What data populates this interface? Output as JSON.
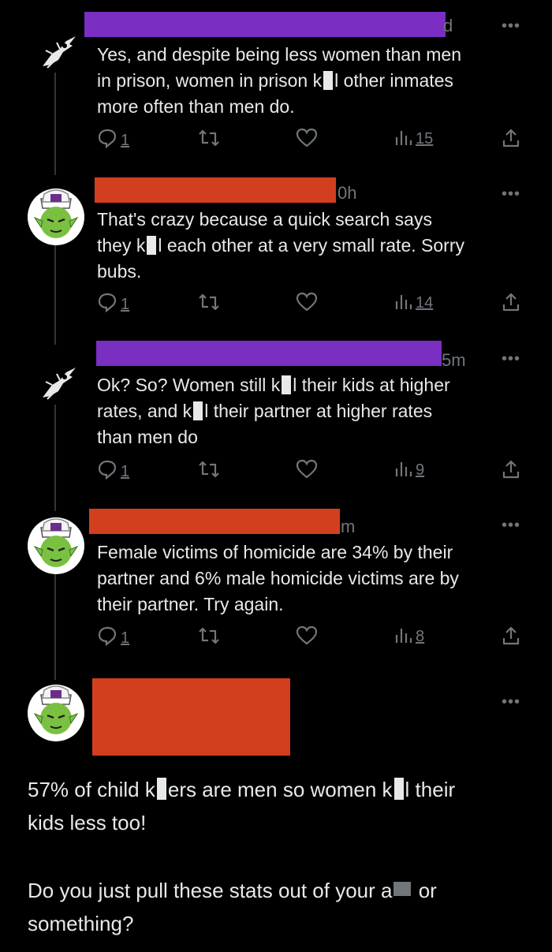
{
  "tweets": [
    {
      "time_fragment": "d",
      "more": "•••",
      "lines": [
        "Yes, and despite being less women than men",
        "in prison, women in prison k",
        "l other inmates",
        "more often than men do."
      ],
      "replies": "1",
      "views": "15"
    },
    {
      "time_fragment": "0h",
      "more": "•••",
      "lines": [
        "That's crazy because a quick search says",
        "they k",
        "l each other at a very small rate. Sorry",
        "bubs."
      ],
      "replies": "1",
      "views": "14"
    },
    {
      "time_fragment": "5m",
      "more": "•••",
      "lines": [
        "Ok? So? Women still k",
        "l their kids at higher",
        "rates, and k",
        "l their partner at higher rates",
        "than men do"
      ],
      "replies": "1",
      "views": "9"
    },
    {
      "time_fragment": "m",
      "more": "•••",
      "lines": [
        "Female victims of homicide are 34% by their",
        "partner and 6% male homicide victims are by",
        "their partner. Try again."
      ],
      "replies": "1",
      "views": "8"
    },
    {
      "more": "•••",
      "para1": [
        "57% of child k",
        "ers are men so women k",
        "l their",
        "kids less too!"
      ],
      "para2": [
        "Do you just pull these stats out of your a",
        "or",
        "something?"
      ]
    }
  ],
  "colors": {
    "redact_purple": "#7a2ec2",
    "redact_orange": "#d23f1e",
    "icon_gray": "#71767b",
    "text": "#e7e9ea"
  }
}
